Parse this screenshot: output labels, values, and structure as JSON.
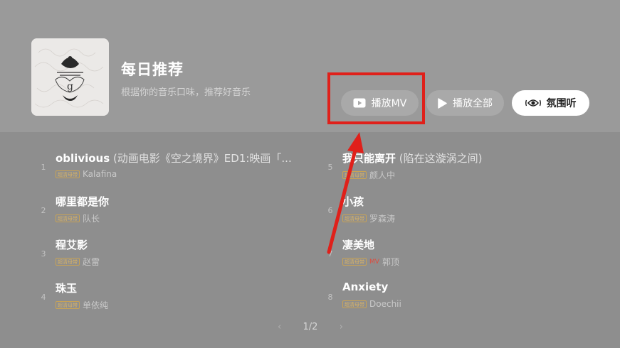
{
  "header": {
    "title": "每日推荐",
    "subtitle": "根据你的音乐口味，推荐好音乐"
  },
  "buttons": {
    "play_mv": "播放MV",
    "play_all": "播放全部",
    "atmosphere": "氛围听"
  },
  "badge_label": "超清母带",
  "mv_badge": "MV",
  "songs_left": [
    {
      "num": "1",
      "name": "oblivious",
      "sub": " (动画电影《空之境界》ED1:映画「...",
      "artist": "Kalafina"
    },
    {
      "num": "2",
      "name": "哪里都是你",
      "sub": "",
      "artist": "队长"
    },
    {
      "num": "3",
      "name": "程艾影",
      "sub": "",
      "artist": "赵雷"
    },
    {
      "num": "4",
      "name": "珠玉",
      "sub": "",
      "artist": "单依纯"
    }
  ],
  "songs_right": [
    {
      "num": "5",
      "name": "我只能离开",
      "sub": " (陷在这漩涡之间)",
      "artist": "颜人中"
    },
    {
      "num": "6",
      "name": "小孩",
      "sub": "",
      "artist": "罗森涛"
    },
    {
      "num": "7",
      "name": "凄美地",
      "sub": "",
      "artist": "郭顶"
    },
    {
      "num": "8",
      "name": "Anxiety",
      "sub": "",
      "artist": "Doechii"
    }
  ],
  "pager": {
    "label": "1/2"
  },
  "colors": {
    "highlight": "#e0201a",
    "badge": "#c9a355",
    "mv": "#e14a3c"
  },
  "icons": {
    "play_mv": "video-play-icon",
    "play_all": "play-triangle-icon",
    "atmosphere": "eye-waves-icon",
    "prev": "chevron-left-icon",
    "next": "chevron-right-icon"
  }
}
